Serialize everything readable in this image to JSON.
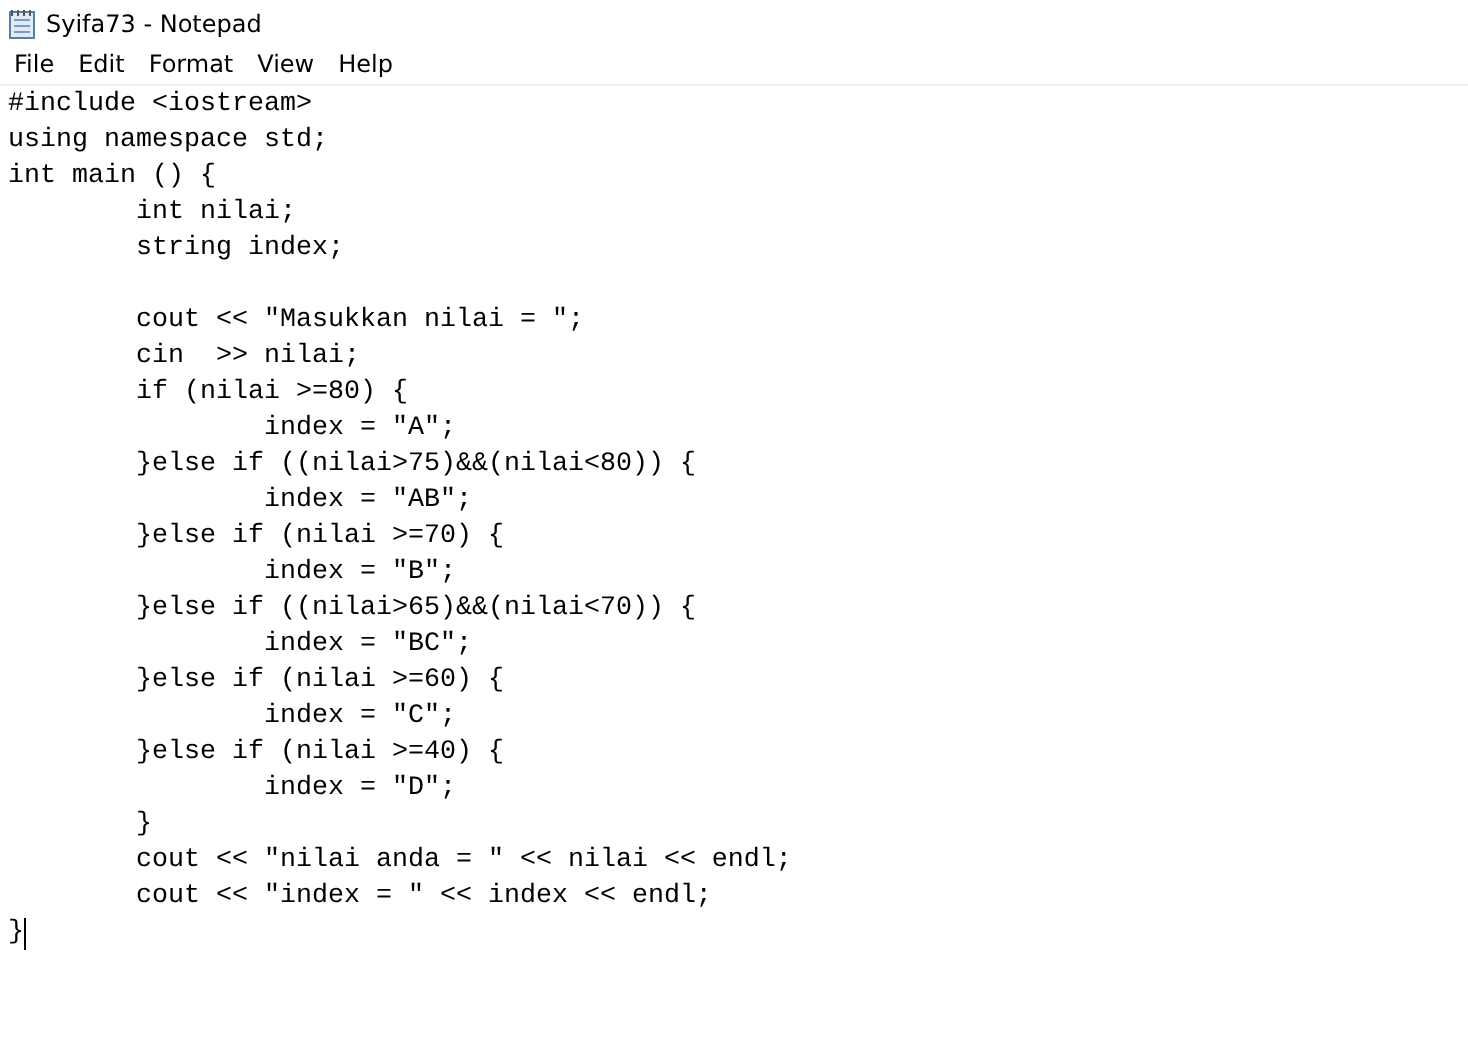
{
  "window": {
    "title": "Syifa73 - Notepad"
  },
  "menu": [
    "File",
    "Edit",
    "Format",
    "View",
    "Help"
  ],
  "editor": {
    "code": "#include <iostream>\nusing namespace std;\nint main () {\n\tint nilai;\n\tstring index;\n\n\tcout << \"Masukkan nilai = \";\n\tcin  >> nilai;\n\tif (nilai >=80) {\n\t\tindex = \"A\";\n\t}else if ((nilai>75)&&(nilai<80)) {\n\t\tindex = \"AB\";\n\t}else if (nilai >=70) {\n\t\tindex = \"B\";\n\t}else if ((nilai>65)&&(nilai<70)) {\n\t\tindex = \"BC\";\n\t}else if (nilai >=60) {\n\t\tindex = \"C\";\n\t}else if (nilai >=40) {\n\t\tindex = \"D\";\n\t}\n\tcout << \"nilai anda = \" << nilai << endl;\n\tcout << \"index = \" << index << endl;\n}"
  }
}
